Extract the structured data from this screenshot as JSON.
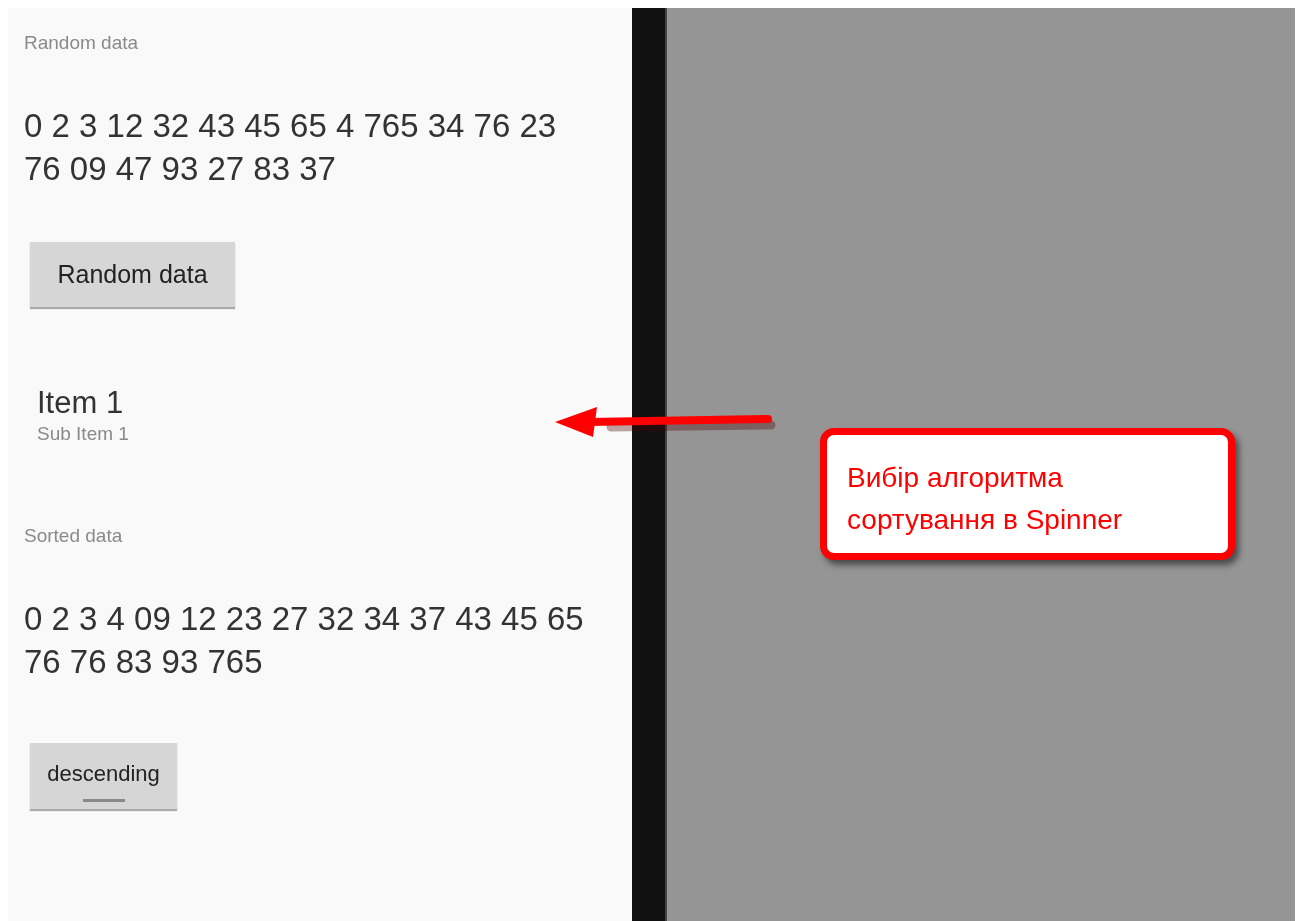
{
  "random_section": {
    "label": "Random data",
    "values": "0 2 3 12 32 43 45 65 4 765 34 76 23 76 09 47 93 27 83 37",
    "button": "Random data"
  },
  "spinner": {
    "title": "Item 1",
    "subtitle": "Sub Item 1"
  },
  "sorted_section": {
    "label": "Sorted data",
    "values": "0 2 3 4 09 12 23 27 32 34 37 43 45 65 76 76 83 93 765"
  },
  "toggle": {
    "label": "descending",
    "on": false
  },
  "annotation": {
    "text": "Вибір алгоритма сортування в Spinner"
  }
}
